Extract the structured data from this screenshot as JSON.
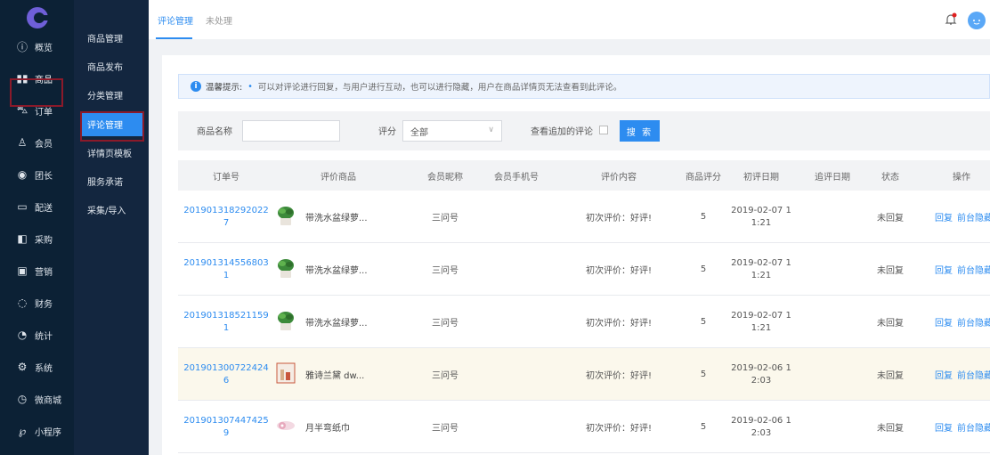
{
  "sidebar": {
    "items": [
      {
        "label": "概览",
        "icon": "info-circle-icon"
      },
      {
        "label": "商品",
        "icon": "barcode-icon"
      },
      {
        "label": "订单",
        "icon": "cart-icon"
      },
      {
        "label": "会员",
        "icon": "user-icon"
      },
      {
        "label": "团长",
        "icon": "medal-icon"
      },
      {
        "label": "配送",
        "icon": "truck-icon"
      },
      {
        "label": "采购",
        "icon": "bag-icon"
      },
      {
        "label": "营销",
        "icon": "coupon-icon"
      },
      {
        "label": "财务",
        "icon": "money-bag-icon"
      },
      {
        "label": "统计",
        "icon": "pie-chart-icon"
      },
      {
        "label": "系统",
        "icon": "gear-icon"
      },
      {
        "label": "微商城",
        "icon": "shop-icon"
      },
      {
        "label": "小程序",
        "icon": "miniprogram-icon"
      }
    ]
  },
  "subnav": {
    "items": [
      {
        "label": "商品管理"
      },
      {
        "label": "商品发布"
      },
      {
        "label": "分类管理"
      },
      {
        "label": "评论管理"
      },
      {
        "label": "详情页模板"
      },
      {
        "label": "服务承诺"
      },
      {
        "label": "采集/导入"
      }
    ]
  },
  "tabs": [
    {
      "label": "评论管理"
    },
    {
      "label": "未处理"
    }
  ],
  "notice": {
    "title": "温馨提示:",
    "text": "可以对评论进行回复，与用户进行互动，也可以进行隐藏，用户在商品详情页无法查看到此评论。"
  },
  "filter": {
    "goods_name_label": "商品名称",
    "goods_name_value": "",
    "rating_label": "评分",
    "rating_value": "全部",
    "append_label": "查看追加的评论",
    "search_label": "搜 索"
  },
  "table": {
    "headers": [
      "订单号",
      "评价商品",
      "会员昵称",
      "会员手机号",
      "评价内容",
      "商品评分",
      "初评日期",
      "追评日期",
      "状态",
      "操作"
    ],
    "rows": [
      {
        "order": [
          "201901318292022",
          "7"
        ],
        "goods": "带洗水盆绿萝...",
        "nick": "三问号",
        "phone": "",
        "content": "初次评价：好评!",
        "score": "5",
        "date": [
          "2019-02-07 1",
          "1:21"
        ],
        "append_date": "",
        "status": "未回复",
        "reply": "回复",
        "hide": "前台隐藏"
      },
      {
        "order": [
          "201901314556803",
          "1"
        ],
        "goods": "带洗水盆绿萝...",
        "nick": "三问号",
        "phone": "",
        "content": "初次评价：好评!",
        "score": "5",
        "date": [
          "2019-02-07 1",
          "1:21"
        ],
        "append_date": "",
        "status": "未回复",
        "reply": "回复",
        "hide": "前台隐藏"
      },
      {
        "order": [
          "201901318521159",
          "1"
        ],
        "goods": "带洗水盆绿萝...",
        "nick": "三问号",
        "phone": "",
        "content": "初次评价：好评!",
        "score": "5",
        "date": [
          "2019-02-07 1",
          "1:21"
        ],
        "append_date": "",
        "status": "未回复",
        "reply": "回复",
        "hide": "前台隐藏"
      },
      {
        "order": [
          "201901300722424",
          "6"
        ],
        "goods": "雅诗兰黛 dw...",
        "nick": "三问号",
        "phone": "",
        "content": "初次评价：好评!",
        "score": "5",
        "date": [
          "2019-02-06 1",
          "2:03"
        ],
        "append_date": "",
        "status": "未回复",
        "reply": "回复",
        "hide": "前台隐藏"
      },
      {
        "order": [
          "201901307447425",
          "9"
        ],
        "goods": "月半弯纸巾",
        "nick": "三问号",
        "phone": "",
        "content": "初次评价：好评!",
        "score": "5",
        "date": [
          "2019-02-06 1",
          "2:03"
        ],
        "append_date": "",
        "status": "未回复",
        "reply": "回复",
        "hide": "前台隐藏"
      }
    ]
  },
  "colors": {
    "accent": "#2d8cf0",
    "sidebar_bg": "#0c2135",
    "subnav_bg": "#13263f",
    "highlight_box": "#8b1a2a",
    "logo_purple": "#6f5fd8"
  }
}
